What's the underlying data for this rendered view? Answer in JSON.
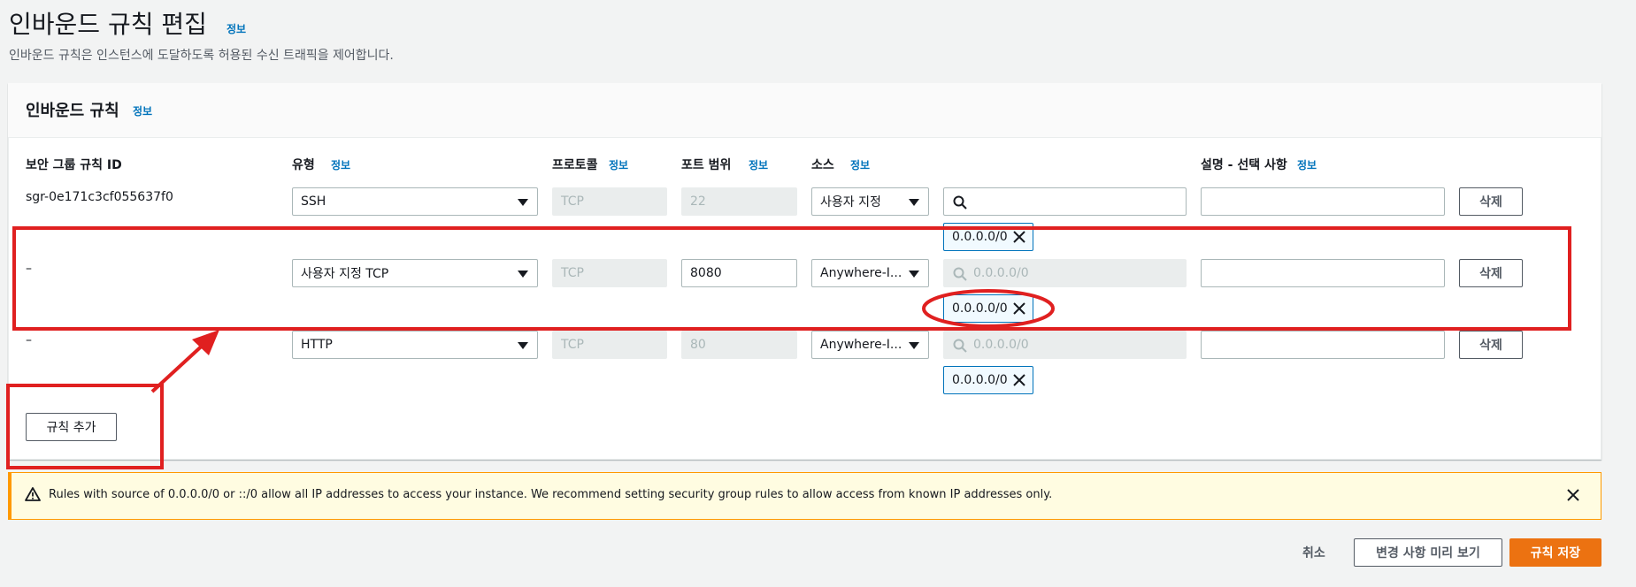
{
  "page": {
    "title": "인바운드 규칙 편집",
    "title_info": "정보",
    "description": "인바운드 규칙은 인스턴스에 도달하도록 허용된 수신 트래픽을 제어합니다."
  },
  "panel": {
    "title": "인바운드 규칙",
    "title_info": "정보",
    "columns": {
      "rule_id": "보안 그룹 규칙 ID",
      "type": "유형",
      "type_info": "정보",
      "protocol": "프로토콜",
      "protocol_info": "정보",
      "port_range": "포트 범위",
      "port_range_info": "정보",
      "source": "소스",
      "source_info": "정보",
      "description": "설명 - 선택 사항",
      "description_info": "정보"
    },
    "rows": [
      {
        "rule_id": "sgr-0e171c3cf055637f0",
        "type": "SSH",
        "protocol": "TCP",
        "port": "22",
        "source": "사용자 지정",
        "search_placeholder": "",
        "token": "0.0.0.0/0",
        "delete": "삭제"
      },
      {
        "rule_id": "–",
        "type": "사용자 지정 TCP",
        "protocol": "TCP",
        "port": "8080",
        "source": "Anywhere-I...",
        "search_placeholder": "0.0.0.0/0",
        "token": "0.0.0.0/0",
        "delete": "삭제"
      },
      {
        "rule_id": "–",
        "type": "HTTP",
        "protocol": "TCP",
        "port": "80",
        "source": "Anywhere-I...",
        "search_placeholder": "0.0.0.0/0",
        "token": "0.0.0.0/0",
        "delete": "삭제"
      }
    ],
    "add_rule": "규칙 추가"
  },
  "warning": {
    "text": "Rules with source of 0.0.0.0/0 or ::/0 allow all IP addresses to access your instance. We recommend setting security group rules to allow access from known IP addresses only."
  },
  "footer": {
    "cancel": "취소",
    "preview": "변경 사항 미리 보기",
    "save": "규칙 저장"
  },
  "colors": {
    "accent": "#0073bb",
    "primary_button": "#ec7211",
    "annotation": "#e02020",
    "warning_border": "#ff9900"
  },
  "icons": [
    "search-icon",
    "close-icon",
    "warning-icon",
    "caret-down-icon"
  ]
}
